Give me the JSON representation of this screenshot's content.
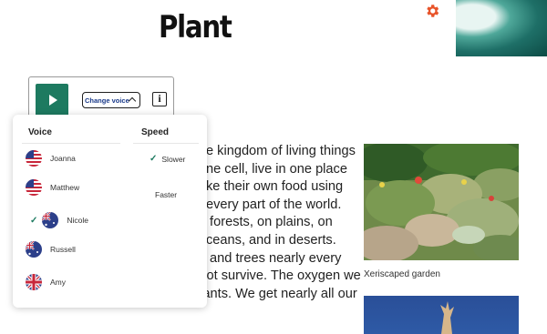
{
  "page": {
    "title": "Plant"
  },
  "player": {
    "change_voice_label": "Change voice",
    "info_label": "i"
  },
  "dropdown": {
    "voice_heading": "Voice",
    "speed_heading": "Speed",
    "voices": [
      {
        "name": "Joanna",
        "flag": "us-flag-icon",
        "selected": false
      },
      {
        "name": "Matthew",
        "flag": "us-flag-icon",
        "selected": false
      },
      {
        "name": "Nicole",
        "flag": "au-flag-icon",
        "selected": true
      },
      {
        "name": "Russell",
        "flag": "au-flag-icon",
        "selected": false
      },
      {
        "name": "Amy",
        "flag": "uk-flag-icon",
        "selected": false
      }
    ],
    "speeds": [
      {
        "name": "Slower",
        "selected": true
      },
      {
        "name": "Faster",
        "selected": false
      }
    ]
  },
  "article": {
    "lines": [
      "e kingdom of living things",
      "ne cell, live in one place",
      "ke their own food using",
      "every part of the world.",
      " forests, on plains, on",
      "ceans, and in deserts.",
      " and trees nearly every",
      "",
      "Without plants, people could not survive. The oxygen we",
      "breathe comes mostly from plants. We get nearly all our"
    ]
  },
  "figure": {
    "caption": "Xeriscaped garden"
  },
  "colors": {
    "accent": "#1d7a60",
    "gear": "#e8542a",
    "link": "#1a3a8a"
  }
}
